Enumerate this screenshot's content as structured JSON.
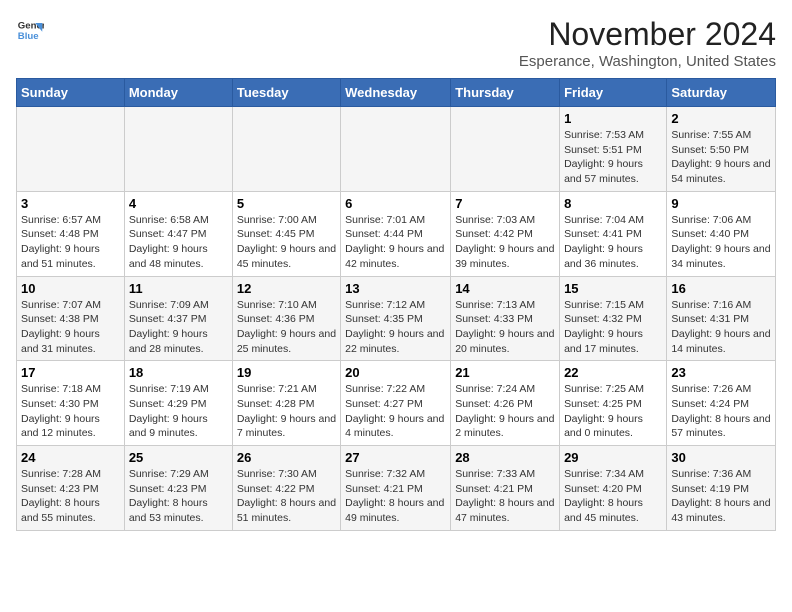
{
  "header": {
    "logo_line1": "General",
    "logo_line2": "Blue",
    "month_title": "November 2024",
    "location": "Esperance, Washington, United States"
  },
  "days_of_week": [
    "Sunday",
    "Monday",
    "Tuesday",
    "Wednesday",
    "Thursday",
    "Friday",
    "Saturday"
  ],
  "weeks": [
    [
      {
        "day": "",
        "info": ""
      },
      {
        "day": "",
        "info": ""
      },
      {
        "day": "",
        "info": ""
      },
      {
        "day": "",
        "info": ""
      },
      {
        "day": "",
        "info": ""
      },
      {
        "day": "1",
        "info": "Sunrise: 7:53 AM\nSunset: 5:51 PM\nDaylight: 9 hours and 57 minutes."
      },
      {
        "day": "2",
        "info": "Sunrise: 7:55 AM\nSunset: 5:50 PM\nDaylight: 9 hours and 54 minutes."
      }
    ],
    [
      {
        "day": "3",
        "info": "Sunrise: 6:57 AM\nSunset: 4:48 PM\nDaylight: 9 hours and 51 minutes."
      },
      {
        "day": "4",
        "info": "Sunrise: 6:58 AM\nSunset: 4:47 PM\nDaylight: 9 hours and 48 minutes."
      },
      {
        "day": "5",
        "info": "Sunrise: 7:00 AM\nSunset: 4:45 PM\nDaylight: 9 hours and 45 minutes."
      },
      {
        "day": "6",
        "info": "Sunrise: 7:01 AM\nSunset: 4:44 PM\nDaylight: 9 hours and 42 minutes."
      },
      {
        "day": "7",
        "info": "Sunrise: 7:03 AM\nSunset: 4:42 PM\nDaylight: 9 hours and 39 minutes."
      },
      {
        "day": "8",
        "info": "Sunrise: 7:04 AM\nSunset: 4:41 PM\nDaylight: 9 hours and 36 minutes."
      },
      {
        "day": "9",
        "info": "Sunrise: 7:06 AM\nSunset: 4:40 PM\nDaylight: 9 hours and 34 minutes."
      }
    ],
    [
      {
        "day": "10",
        "info": "Sunrise: 7:07 AM\nSunset: 4:38 PM\nDaylight: 9 hours and 31 minutes."
      },
      {
        "day": "11",
        "info": "Sunrise: 7:09 AM\nSunset: 4:37 PM\nDaylight: 9 hours and 28 minutes."
      },
      {
        "day": "12",
        "info": "Sunrise: 7:10 AM\nSunset: 4:36 PM\nDaylight: 9 hours and 25 minutes."
      },
      {
        "day": "13",
        "info": "Sunrise: 7:12 AM\nSunset: 4:35 PM\nDaylight: 9 hours and 22 minutes."
      },
      {
        "day": "14",
        "info": "Sunrise: 7:13 AM\nSunset: 4:33 PM\nDaylight: 9 hours and 20 minutes."
      },
      {
        "day": "15",
        "info": "Sunrise: 7:15 AM\nSunset: 4:32 PM\nDaylight: 9 hours and 17 minutes."
      },
      {
        "day": "16",
        "info": "Sunrise: 7:16 AM\nSunset: 4:31 PM\nDaylight: 9 hours and 14 minutes."
      }
    ],
    [
      {
        "day": "17",
        "info": "Sunrise: 7:18 AM\nSunset: 4:30 PM\nDaylight: 9 hours and 12 minutes."
      },
      {
        "day": "18",
        "info": "Sunrise: 7:19 AM\nSunset: 4:29 PM\nDaylight: 9 hours and 9 minutes."
      },
      {
        "day": "19",
        "info": "Sunrise: 7:21 AM\nSunset: 4:28 PM\nDaylight: 9 hours and 7 minutes."
      },
      {
        "day": "20",
        "info": "Sunrise: 7:22 AM\nSunset: 4:27 PM\nDaylight: 9 hours and 4 minutes."
      },
      {
        "day": "21",
        "info": "Sunrise: 7:24 AM\nSunset: 4:26 PM\nDaylight: 9 hours and 2 minutes."
      },
      {
        "day": "22",
        "info": "Sunrise: 7:25 AM\nSunset: 4:25 PM\nDaylight: 9 hours and 0 minutes."
      },
      {
        "day": "23",
        "info": "Sunrise: 7:26 AM\nSunset: 4:24 PM\nDaylight: 8 hours and 57 minutes."
      }
    ],
    [
      {
        "day": "24",
        "info": "Sunrise: 7:28 AM\nSunset: 4:23 PM\nDaylight: 8 hours and 55 minutes."
      },
      {
        "day": "25",
        "info": "Sunrise: 7:29 AM\nSunset: 4:23 PM\nDaylight: 8 hours and 53 minutes."
      },
      {
        "day": "26",
        "info": "Sunrise: 7:30 AM\nSunset: 4:22 PM\nDaylight: 8 hours and 51 minutes."
      },
      {
        "day": "27",
        "info": "Sunrise: 7:32 AM\nSunset: 4:21 PM\nDaylight: 8 hours and 49 minutes."
      },
      {
        "day": "28",
        "info": "Sunrise: 7:33 AM\nSunset: 4:21 PM\nDaylight: 8 hours and 47 minutes."
      },
      {
        "day": "29",
        "info": "Sunrise: 7:34 AM\nSunset: 4:20 PM\nDaylight: 8 hours and 45 minutes."
      },
      {
        "day": "30",
        "info": "Sunrise: 7:36 AM\nSunset: 4:19 PM\nDaylight: 8 hours and 43 minutes."
      }
    ]
  ]
}
